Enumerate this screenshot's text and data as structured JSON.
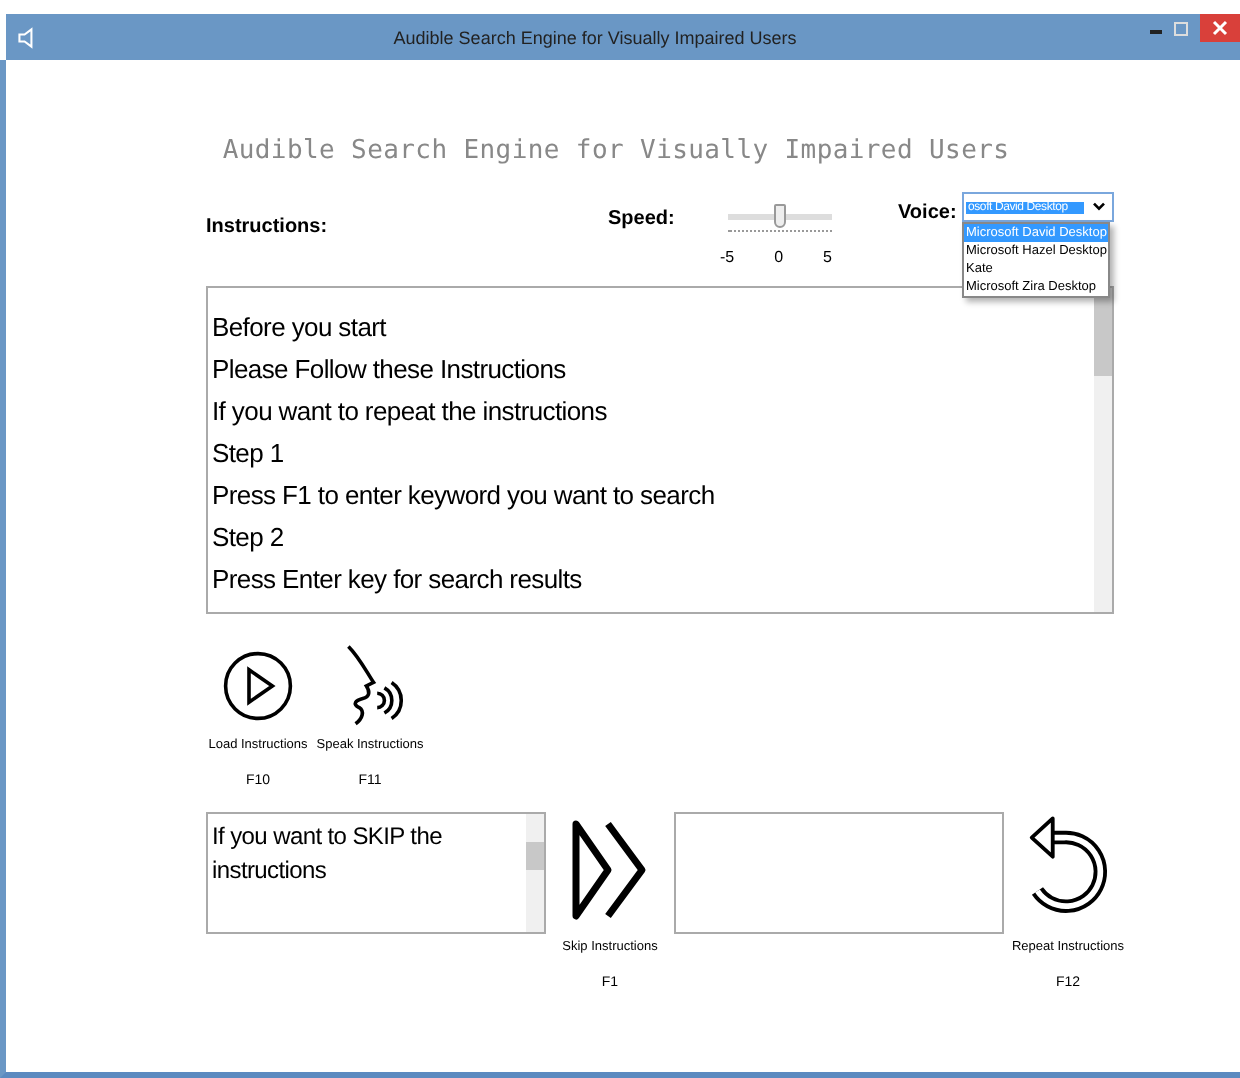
{
  "window": {
    "title": "Audible Search Engine for Visually Impaired Users"
  },
  "heading": "Audible Search Engine for Visually Impaired Users",
  "instructions_label": "Instructions:",
  "speed": {
    "label": "Speed:",
    "level": 0.5,
    "ticks": [
      "-5",
      "0",
      "5"
    ]
  },
  "voice": {
    "label": "Voice:",
    "value": "osoft David Desktop",
    "expanded": true,
    "options": [
      {
        "label": "Microsoft David Desktop",
        "selected": true
      },
      {
        "label": "Microsoft Hazel Desktop",
        "selected": false
      },
      {
        "label": "Kate",
        "selected": false
      },
      {
        "label": "Microsoft Zira Desktop",
        "selected": false
      }
    ]
  },
  "instructions_text": [
    "Before you start",
    "Please Follow these Instructions",
    "If you want to repeat the instructions",
    "Step 1",
    "Press F1 to enter keyword you want to search",
    "Step 2",
    "Press Enter key for search results"
  ],
  "top_actions": [
    {
      "kind": "play",
      "label": "Load Instructions",
      "key": "F10"
    },
    {
      "kind": "speak",
      "label": "Speak Instructions",
      "key": "F11"
    }
  ],
  "skip_box": {
    "value": "If you want to SKIP the instructions"
  },
  "skip": {
    "kind": "skip",
    "label": "Skip Instructions",
    "key": "F1"
  },
  "repeat": {
    "kind": "repeat",
    "label": "Repeat Instructions",
    "key": "F12"
  }
}
